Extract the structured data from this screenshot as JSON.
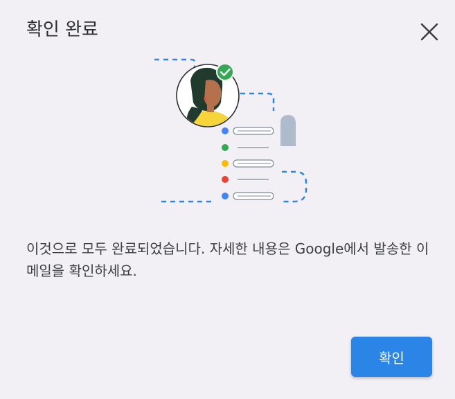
{
  "dialog": {
    "title": "확인 완료",
    "message": "이것으로 모두 완료되었습니다. 자세한 내용은 Google에서 발송한 이메일을 확인하세요.",
    "confirm_label": "확인"
  },
  "icons": {
    "close": "close-icon",
    "illustration": "verified-user-checklist-illustration"
  },
  "colors": {
    "background": "#f2f0f5",
    "accent": "#2a85e6",
    "check_green": "#34a853",
    "dot_blue": "#4285f4",
    "dot_green": "#34a853",
    "dot_yellow": "#fbbc04",
    "dot_red": "#ea4335"
  }
}
